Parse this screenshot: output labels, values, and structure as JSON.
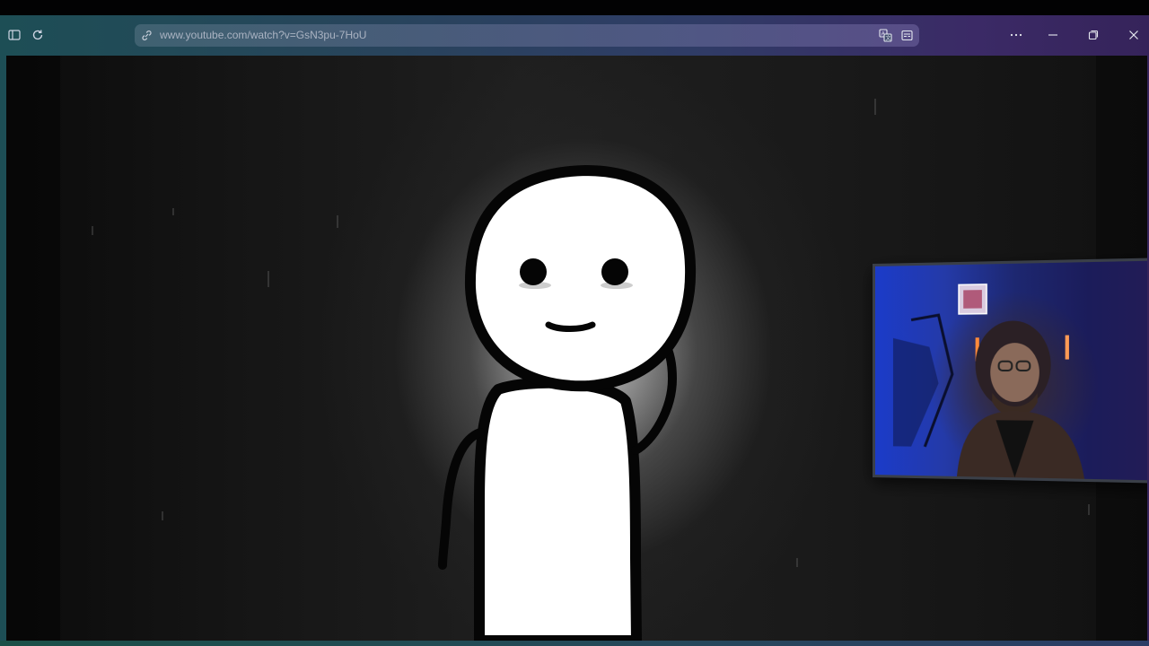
{
  "browser": {
    "url_domain": "www.youtube.com",
    "url_path": "/watch?v=GsN3pu-7HoU",
    "toolbar_icons": {
      "sidebar": "sidebar-toggle-icon",
      "reload": "reload-icon",
      "site_info": "site-info-icon",
      "translate": "translate-icon",
      "reader": "reader-view-icon"
    },
    "window_controls": [
      "more-menu-icon",
      "minimize-icon",
      "restore-icon",
      "close-icon"
    ]
  },
  "video": {
    "content": "stick-figure-animation",
    "overlay": "webcam-picture-in-picture"
  },
  "colors": {
    "frame_start": "#1d4e55",
    "frame_end": "#35235a",
    "video_bg": "#151515",
    "figure_fill": "#ffffff",
    "figure_stroke": "#050505"
  }
}
